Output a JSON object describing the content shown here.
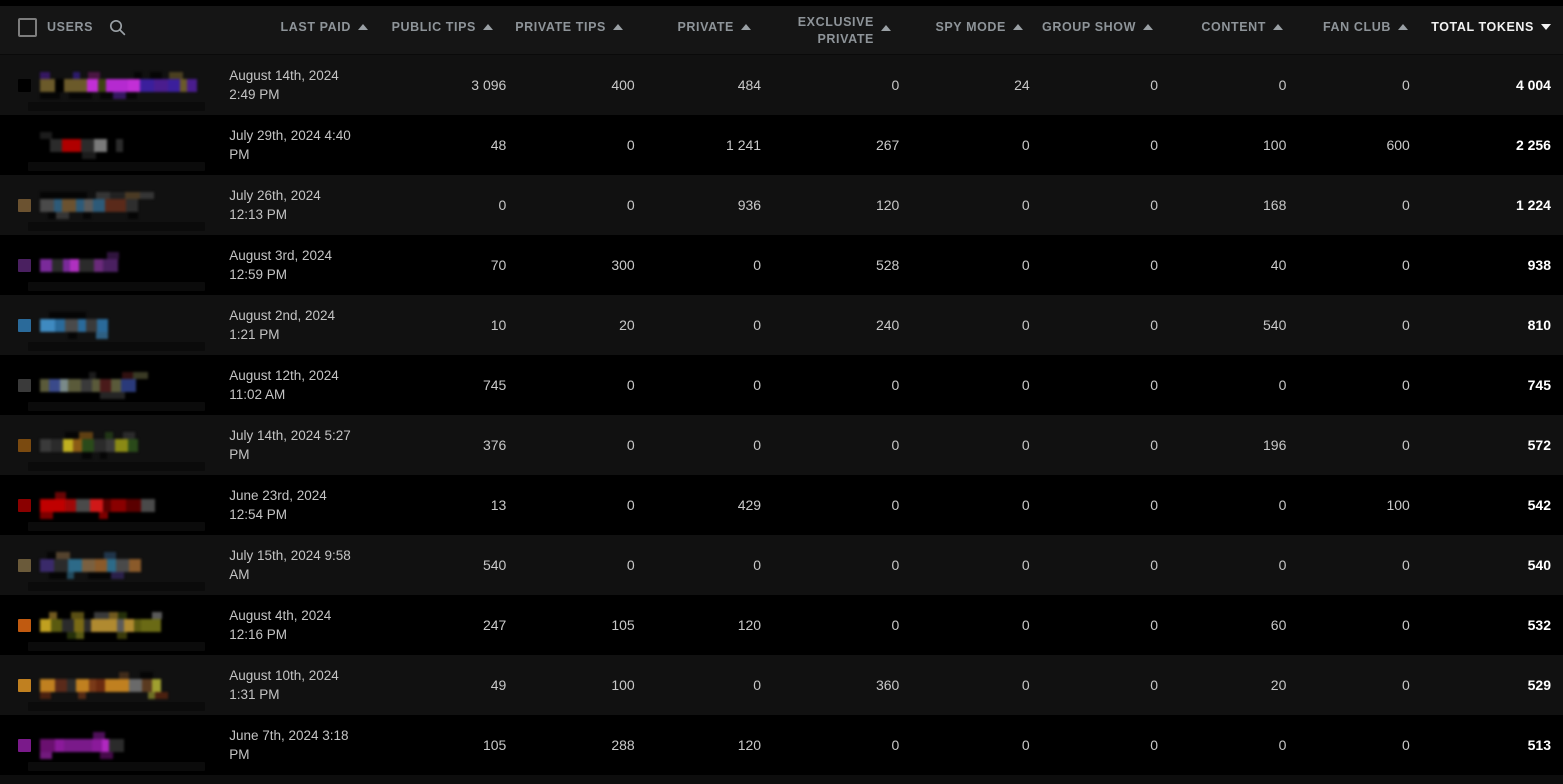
{
  "header": {
    "users": {
      "checkbox_checked": false,
      "label": "USERS",
      "search_icon": "search-icon"
    },
    "columns": [
      {
        "label": "LAST PAID",
        "sort": "asc",
        "active": false
      },
      {
        "label": "PUBLIC TIPS",
        "sort": "asc",
        "active": false
      },
      {
        "label": "PRIVATE TIPS",
        "sort": "asc",
        "active": false
      },
      {
        "label": "PRIVATE",
        "sort": "asc",
        "active": false
      },
      {
        "label": "EXCLUSIVE PRIVATE",
        "line1": "EXCLUSIVE",
        "line2": "PRIVATE",
        "sort": "asc",
        "active": false
      },
      {
        "label": "SPY MODE",
        "sort": "asc",
        "active": false
      },
      {
        "label": "GROUP SHOW",
        "sort": "asc",
        "active": false
      },
      {
        "label": "CONTENT",
        "sort": "asc",
        "active": false
      },
      {
        "label": "FAN CLUB",
        "sort": "asc",
        "active": false
      },
      {
        "label": "TOTAL TOKENS",
        "sort": "desc",
        "active": true
      }
    ]
  },
  "rows": [
    {
      "user": "redacted",
      "last_paid_date": "August 14th, 2024",
      "last_paid_time": "2:49 PM",
      "public_tips": "3 096",
      "private_tips": "400",
      "private": "484",
      "exclusive_private": "0",
      "spy_mode": "24",
      "group_show": "0",
      "content": "0",
      "fan_club": "0",
      "total_tokens": "4 004"
    },
    {
      "user": "redacted",
      "last_paid_date": "July 29th, 2024 4:40",
      "last_paid_time": "PM",
      "public_tips": "48",
      "private_tips": "0",
      "private": "1 241",
      "exclusive_private": "267",
      "spy_mode": "0",
      "group_show": "0",
      "content": "100",
      "fan_club": "600",
      "total_tokens": "2 256"
    },
    {
      "user": "redacted",
      "last_paid_date": "July 26th, 2024",
      "last_paid_time": "12:13 PM",
      "public_tips": "0",
      "private_tips": "0",
      "private": "936",
      "exclusive_private": "120",
      "spy_mode": "0",
      "group_show": "0",
      "content": "168",
      "fan_club": "0",
      "total_tokens": "1 224"
    },
    {
      "user": "redacted",
      "last_paid_date": "August 3rd, 2024",
      "last_paid_time": "12:59 PM",
      "public_tips": "70",
      "private_tips": "300",
      "private": "0",
      "exclusive_private": "528",
      "spy_mode": "0",
      "group_show": "0",
      "content": "40",
      "fan_club": "0",
      "total_tokens": "938"
    },
    {
      "user": "redacted",
      "last_paid_date": "August 2nd, 2024",
      "last_paid_time": "1:21 PM",
      "public_tips": "10",
      "private_tips": "20",
      "private": "0",
      "exclusive_private": "240",
      "spy_mode": "0",
      "group_show": "0",
      "content": "540",
      "fan_club": "0",
      "total_tokens": "810"
    },
    {
      "user": "redacted",
      "last_paid_date": "August 12th, 2024",
      "last_paid_time": "11:02 AM",
      "public_tips": "745",
      "private_tips": "0",
      "private": "0",
      "exclusive_private": "0",
      "spy_mode": "0",
      "group_show": "0",
      "content": "0",
      "fan_club": "0",
      "total_tokens": "745"
    },
    {
      "user": "redacted",
      "last_paid_date": "July 14th, 2024 5:27",
      "last_paid_time": "PM",
      "public_tips": "376",
      "private_tips": "0",
      "private": "0",
      "exclusive_private": "0",
      "spy_mode": "0",
      "group_show": "0",
      "content": "196",
      "fan_club": "0",
      "total_tokens": "572"
    },
    {
      "user": "redacted",
      "last_paid_date": "June 23rd, 2024",
      "last_paid_time": "12:54 PM",
      "public_tips": "13",
      "private_tips": "0",
      "private": "429",
      "exclusive_private": "0",
      "spy_mode": "0",
      "group_show": "0",
      "content": "0",
      "fan_club": "100",
      "total_tokens": "542"
    },
    {
      "user": "redacted",
      "last_paid_date": "July 15th, 2024 9:58",
      "last_paid_time": "AM",
      "public_tips": "540",
      "private_tips": "0",
      "private": "0",
      "exclusive_private": "0",
      "spy_mode": "0",
      "group_show": "0",
      "content": "0",
      "fan_club": "0",
      "total_tokens": "540"
    },
    {
      "user": "redacted",
      "last_paid_date": "August 4th, 2024",
      "last_paid_time": "12:16 PM",
      "public_tips": "247",
      "private_tips": "105",
      "private": "120",
      "exclusive_private": "0",
      "spy_mode": "0",
      "group_show": "0",
      "content": "60",
      "fan_club": "0",
      "total_tokens": "532"
    },
    {
      "user": "redacted",
      "last_paid_date": "August 10th, 2024",
      "last_paid_time": "1:31 PM",
      "public_tips": "49",
      "private_tips": "100",
      "private": "0",
      "exclusive_private": "360",
      "spy_mode": "0",
      "group_show": "0",
      "content": "20",
      "fan_club": "0",
      "total_tokens": "529"
    },
    {
      "user": "redacted",
      "last_paid_date": "June 7th, 2024 3:18",
      "last_paid_time": "PM",
      "public_tips": "105",
      "private_tips": "288",
      "private": "120",
      "exclusive_private": "0",
      "spy_mode": "0",
      "group_show": "0",
      "content": "0",
      "fan_club": "0",
      "total_tokens": "513"
    }
  ],
  "redaction_palettes": [
    [
      "#3d4412",
      "#000000",
      "#b024c9",
      "#4a1d8e",
      "#6b1b5e",
      "#b52ad0",
      "#c22fd6",
      "#7e1230",
      "#3b1f9c",
      "#000000",
      "#3c2ad6",
      "#4a1b9c",
      "#b08a4a",
      "#6b5a2a"
    ],
    [
      "#2b2b2b",
      "#000000",
      "#b00000",
      "#5a0000",
      "#000000",
      "#3a3a3a",
      "#7a7a7a",
      "#2e2e2e"
    ],
    [
      "#2e2e2e",
      "#6b5230",
      "#8a6a3a",
      "#5a5a5a",
      "#2d5a78",
      "#3f7fa0",
      "#4a4a4a",
      "#5a2a1a",
      "#2b2b2b"
    ],
    [
      "#2b2b2b",
      "#4a2060",
      "#7a2a9a",
      "#b030c0",
      "#6a2a7a",
      "#3a3a3a",
      "#5a5a5a"
    ],
    [
      "#2b2b2b",
      "#2a6a9a",
      "#3f8ac0",
      "#4a4a4a",
      "#6a6a6a",
      "#3a3a3a"
    ],
    [
      "#2b2b2b",
      "#3a3a3a",
      "#5a5a5a",
      "#2d6a88",
      "#7a8a8a",
      "#5a5a3a",
      "#4a1a1a",
      "#2a3a7a",
      "#3a4a8a"
    ],
    [
      "#2b2b2b",
      "#7a4a10",
      "#8a5a15",
      "#2a4a1a",
      "#8a8a15",
      "#c0b020",
      "#7a5a1a",
      "#4a4a1a",
      "#3a3a3a"
    ],
    [
      "#2b2b2b",
      "#8a0000",
      "#c00000",
      "#5a0000",
      "#c01010",
      "#d01818",
      "#a00808",
      "#3a3a3a",
      "#4a4a4a"
    ],
    [
      "#2b2b2b",
      "#6a5a3a",
      "#7a6040",
      "#3a2a6a",
      "#2a4a6a",
      "#2d6a88",
      "#8a5a2a",
      "#4a4a4a"
    ],
    [
      "#2b2b2b",
      "#c05a10",
      "#5a5a10",
      "#6a6a15",
      "#8a8a20",
      "#7a6a15",
      "#3a4a10",
      "#8a7a20",
      "#c0a020",
      "#b08a30",
      "#8a8a8a",
      "#5a5a5a"
    ],
    [
      "#2b2b2b",
      "#c08020",
      "#8a8a20",
      "#a0a030",
      "#c08020",
      "#6a2a10",
      "#5a2a1a",
      "#7a3a18",
      "#5a3a20",
      "#4a4a4a",
      "#6a6a6a"
    ],
    [
      "#2b2b2b",
      "#7a1a8a",
      "#a020b0",
      "#c030d0",
      "#8a1a9a",
      "#b028c0",
      "#6a1070"
    ]
  ]
}
